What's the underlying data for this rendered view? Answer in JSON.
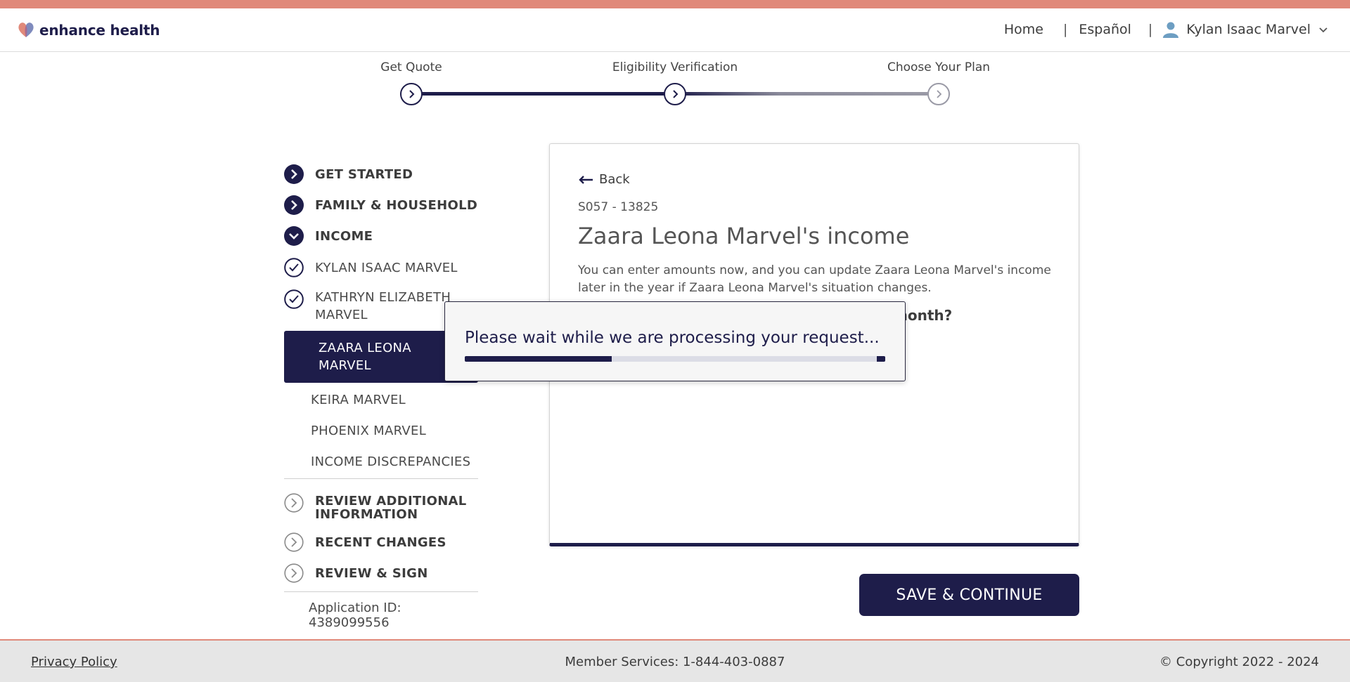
{
  "colors": {
    "navy": "#1e1d4a",
    "accent": "#e0897a",
    "footer_bg": "#e6e6e6"
  },
  "header": {
    "logo_text": "enhance health",
    "nav": {
      "home": "Home",
      "sep1": "|",
      "language": "Español",
      "sep2": "|",
      "user_name": "Kylan Isaac Marvel"
    }
  },
  "stepper": {
    "steps": [
      {
        "label": "Get Quote",
        "state": "done"
      },
      {
        "label": "Eligibility Verification",
        "state": "current"
      },
      {
        "label": "Choose Your Plan",
        "state": "todo"
      }
    ]
  },
  "sidebar": {
    "sections": [
      {
        "label": "GET STARTED",
        "icon": "chevron-right-filled-icon"
      },
      {
        "label": "FAMILY & HOUSEHOLD",
        "icon": "chevron-right-filled-icon"
      },
      {
        "label": "INCOME",
        "icon": "chevron-down-filled-icon"
      }
    ],
    "income_members": [
      {
        "label": "KYLAN ISAAC MARVEL",
        "icon": "check-circle-icon"
      },
      {
        "label": "KATHRYN ELIZABETH MARVEL",
        "icon": "check-circle-icon"
      },
      {
        "label": "ZAARA LEONA MARVEL",
        "active": true
      },
      {
        "label": "KEIRA MARVEL"
      },
      {
        "label": "PHOENIX MARVEL"
      },
      {
        "label": "INCOME DISCREPANCIES"
      }
    ],
    "later_sections": [
      {
        "label": "REVIEW ADDITIONAL INFORMATION",
        "icon": "chevron-right-outline-icon"
      },
      {
        "label": "RECENT CHANGES",
        "icon": "chevron-right-outline-icon"
      },
      {
        "label": "REVIEW & SIGN",
        "icon": "chevron-right-outline-icon"
      }
    ],
    "application_id": "Application ID: 4389099556"
  },
  "card": {
    "back_label": "Back",
    "case_id": "S057 - 13825",
    "title": "Zaara Leona Marvel's income",
    "description": "You can enter amounts now, and you can update Zaara Leona Marvel's income later in the year if Zaara Leona Marvel's situation changes.",
    "question_visible": "month?"
  },
  "save_button_label": "SAVE & CONTINUE",
  "modal": {
    "message": "Please wait while we are processing your request...",
    "progress": 0.35
  },
  "footer": {
    "privacy": "Privacy Policy",
    "member_services": "Member Services: 1-844-403-0887",
    "copyright": "© Copyright 2022 - 2024"
  }
}
